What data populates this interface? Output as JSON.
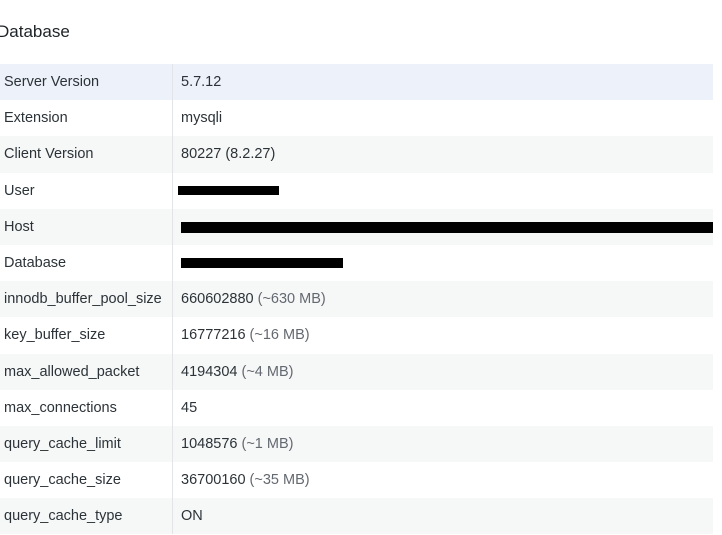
{
  "section": {
    "title": "Database"
  },
  "rows": [
    {
      "label": "Server Version",
      "value": "5.7.12",
      "extra": ""
    },
    {
      "label": "Extension",
      "value": "mysqli",
      "extra": ""
    },
    {
      "label": "Client Version",
      "value": "80227 (8.2.27)",
      "extra": ""
    },
    {
      "label": "User",
      "value": "",
      "extra": "",
      "redacted": true
    },
    {
      "label": "Host",
      "value": "",
      "extra": "",
      "redacted": true
    },
    {
      "label": "Database",
      "value": "",
      "extra": "",
      "redacted": true
    },
    {
      "label": "innodb_buffer_pool_size",
      "value": "660602880",
      "extra": "(~630 MB)"
    },
    {
      "label": "key_buffer_size",
      "value": "16777216",
      "extra": "(~16 MB)"
    },
    {
      "label": "max_allowed_packet",
      "value": "4194304",
      "extra": "(~4 MB)"
    },
    {
      "label": "max_connections",
      "value": "45",
      "extra": ""
    },
    {
      "label": "query_cache_limit",
      "value": "1048576",
      "extra": "(~1 MB)"
    },
    {
      "label": "query_cache_size",
      "value": "36700160",
      "extra": "(~35 MB)"
    },
    {
      "label": "query_cache_type",
      "value": "ON",
      "extra": ""
    }
  ]
}
